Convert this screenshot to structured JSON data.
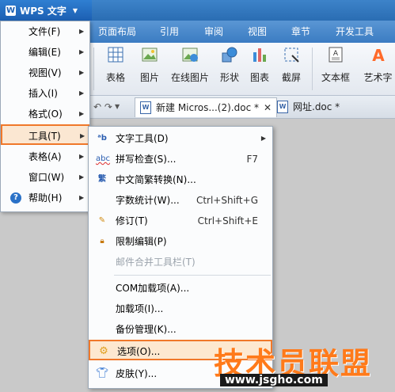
{
  "app": {
    "title": "WPS 文字",
    "logo_letter": "W"
  },
  "menubar": {
    "tabs": [
      "页面布局",
      "引用",
      "审阅",
      "视图",
      "章节",
      "开发工具"
    ]
  },
  "ribbon": {
    "buttons": [
      {
        "label": "表格",
        "icon": "table-icon"
      },
      {
        "label": "图片",
        "icon": "picture-icon"
      },
      {
        "label": "在线图片",
        "icon": "online-picture-icon"
      },
      {
        "label": "形状",
        "icon": "shape-icon"
      },
      {
        "label": "图表",
        "icon": "chart-icon"
      },
      {
        "label": "截屏",
        "icon": "screenshot-icon"
      },
      {
        "label": "文本框",
        "icon": "textbox-icon"
      },
      {
        "label": "艺术字",
        "icon": "wordart-icon"
      }
    ]
  },
  "doc_tabs": [
    {
      "label": "新建 Micros...(2).doc *",
      "close": "✕"
    },
    {
      "label": "网址.doc *"
    }
  ],
  "main_menu": [
    {
      "label": "文件(F)",
      "arrow": true
    },
    {
      "label": "编辑(E)",
      "arrow": true
    },
    {
      "label": "视图(V)",
      "arrow": true
    },
    {
      "label": "插入(I)",
      "arrow": true
    },
    {
      "label": "格式(O)",
      "arrow": true
    },
    {
      "label": "工具(T)",
      "arrow": true,
      "highlighted": true
    },
    {
      "label": "表格(A)",
      "arrow": true
    },
    {
      "label": "窗口(W)",
      "arrow": true
    },
    {
      "label": "帮助(H)",
      "arrow": true,
      "icon": "help-icon"
    }
  ],
  "tools_submenu": [
    {
      "label": "文字工具(D)",
      "icon": "text-tools-icon",
      "arrow": true
    },
    {
      "label": "拼写检查(S)...",
      "icon": "spellcheck-icon",
      "shortcut": "F7"
    },
    {
      "label": "中文简繁转换(N)...",
      "icon": "chinese-convert-icon"
    },
    {
      "label": "字数统计(W)...",
      "shortcut": "Ctrl+Shift+G"
    },
    {
      "label": "修订(T)",
      "icon": "revision-icon",
      "shortcut": "Ctrl+Shift+E"
    },
    {
      "label": "限制编辑(P)",
      "icon": "lock-icon"
    },
    {
      "label": "邮件合并工具栏(T)",
      "disabled": true
    },
    {
      "label": "COM加载项(A)..."
    },
    {
      "label": "加载项(I)..."
    },
    {
      "label": "备份管理(K)..."
    },
    {
      "label": "选项(O)...",
      "icon": "gear-icon",
      "highlighted": true
    },
    {
      "label": "皮肤(Y)...",
      "icon": "skin-icon"
    }
  ],
  "watermark": {
    "text": "技术员联盟",
    "url": "www.jsgho.com"
  },
  "colors": {
    "accent": "#f0782a",
    "titlebar": "#2a6db3",
    "menubar": "#3b7cc2"
  }
}
